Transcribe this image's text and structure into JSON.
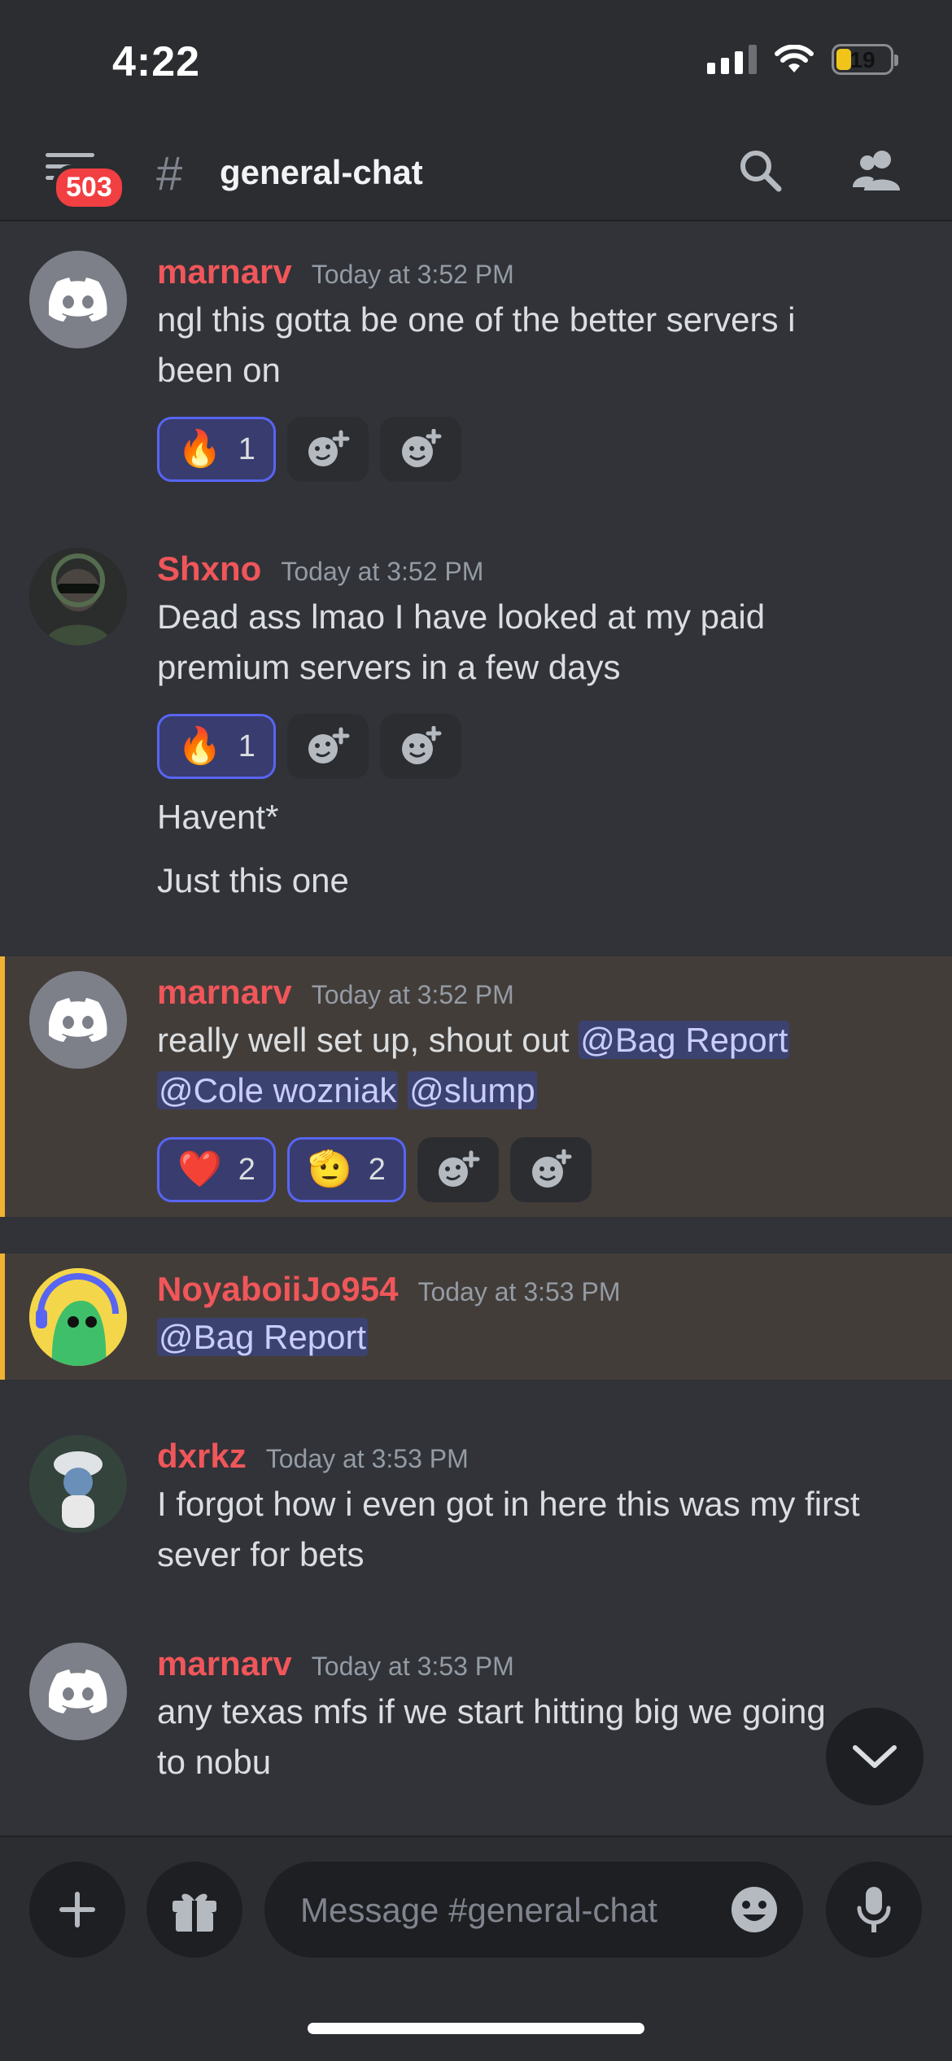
{
  "status_bar": {
    "time": "4:22",
    "battery": "19"
  },
  "header": {
    "unread_badge": "503",
    "hash": "#",
    "channel_name": "general-chat"
  },
  "messages": [
    {
      "author": "marnarv",
      "time": "Today at 3:52 PM",
      "lines": [
        "ngl this gotta be one of the better servers i",
        "been on"
      ],
      "reactions": [
        {
          "emoji": "🔥",
          "count": "1"
        }
      ]
    },
    {
      "author": "Shxno",
      "time": "Today at 3:52 PM",
      "lines": [
        "Dead ass lmao I have looked at my paid",
        "premium servers in a few days"
      ],
      "reactions": [
        {
          "emoji": "🔥",
          "count": "1"
        }
      ],
      "followups": [
        "Havent*",
        "Just this one"
      ]
    },
    {
      "author": "marnarv",
      "time": "Today at 3:52 PM",
      "text_prefix": "really well set up, shout out ",
      "mentions": [
        "@Bag Report",
        "@Cole wozniak",
        "@slump"
      ],
      "reactions": [
        {
          "emoji": "❤️",
          "count": "2"
        },
        {
          "emoji": "🫡",
          "count": "2"
        }
      ]
    },
    {
      "author": "NoyaboiiJo954",
      "time": "Today at 3:53 PM",
      "mentions": [
        "@Bag Report"
      ]
    },
    {
      "author": "dxrkz",
      "time": "Today at 3:53 PM",
      "lines": [
        "I forgot how i even got in here this was my first",
        "sever for bets"
      ]
    },
    {
      "author": "marnarv",
      "time": "Today at 3:53 PM",
      "lines": [
        "any texas mfs if we start hitting big we going",
        "to nobu"
      ]
    }
  ],
  "composer": {
    "placeholder": "Message #general-chat"
  },
  "colors": {
    "background": "#313338",
    "username": "#f0565a",
    "mention_bg": "#3c4270",
    "highlight_bar": "#f0b232"
  }
}
